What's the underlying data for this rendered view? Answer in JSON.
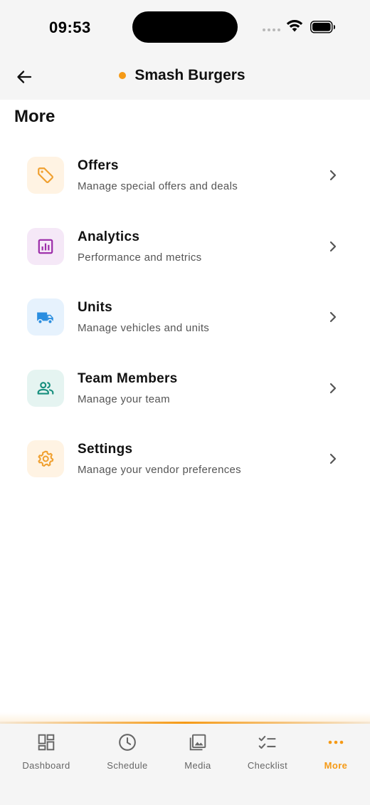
{
  "status_bar": {
    "time": "09:53"
  },
  "header": {
    "title": "Smash Burgers",
    "brand_dot_color": "#f59a16"
  },
  "section": {
    "title": "More"
  },
  "menu": [
    {
      "label": "Offers",
      "subtitle": "Manage special offers and deals",
      "icon": "tag-icon",
      "icon_bg": "#fff3e3",
      "icon_color": "#f0a030"
    },
    {
      "label": "Analytics",
      "subtitle": "Performance and metrics",
      "icon": "analytics-icon",
      "icon_bg": "#f5e8f7",
      "icon_color": "#9b2aa8"
    },
    {
      "label": "Units",
      "subtitle": "Manage vehicles and units",
      "icon": "truck-icon",
      "icon_bg": "#e6f2fd",
      "icon_color": "#2a8ee0"
    },
    {
      "label": "Team Members",
      "subtitle": "Manage your team",
      "icon": "people-icon",
      "icon_bg": "#e5f4f1",
      "icon_color": "#178f7e"
    },
    {
      "label": "Settings",
      "subtitle": "Manage your vendor preferences",
      "icon": "gear-icon",
      "icon_bg": "#fff3e3",
      "icon_color": "#f0a030"
    }
  ],
  "tabs": [
    {
      "label": "Dashboard",
      "icon": "dashboard-icon",
      "active": false
    },
    {
      "label": "Schedule",
      "icon": "clock-icon",
      "active": false
    },
    {
      "label": "Media",
      "icon": "image-icon",
      "active": false
    },
    {
      "label": "Checklist",
      "icon": "checklist-icon",
      "active": false
    },
    {
      "label": "More",
      "icon": "more-icon",
      "active": true
    }
  ],
  "colors": {
    "accent": "#f59a16",
    "header_bg": "#f5f5f5",
    "tab_inactive": "#666666"
  }
}
